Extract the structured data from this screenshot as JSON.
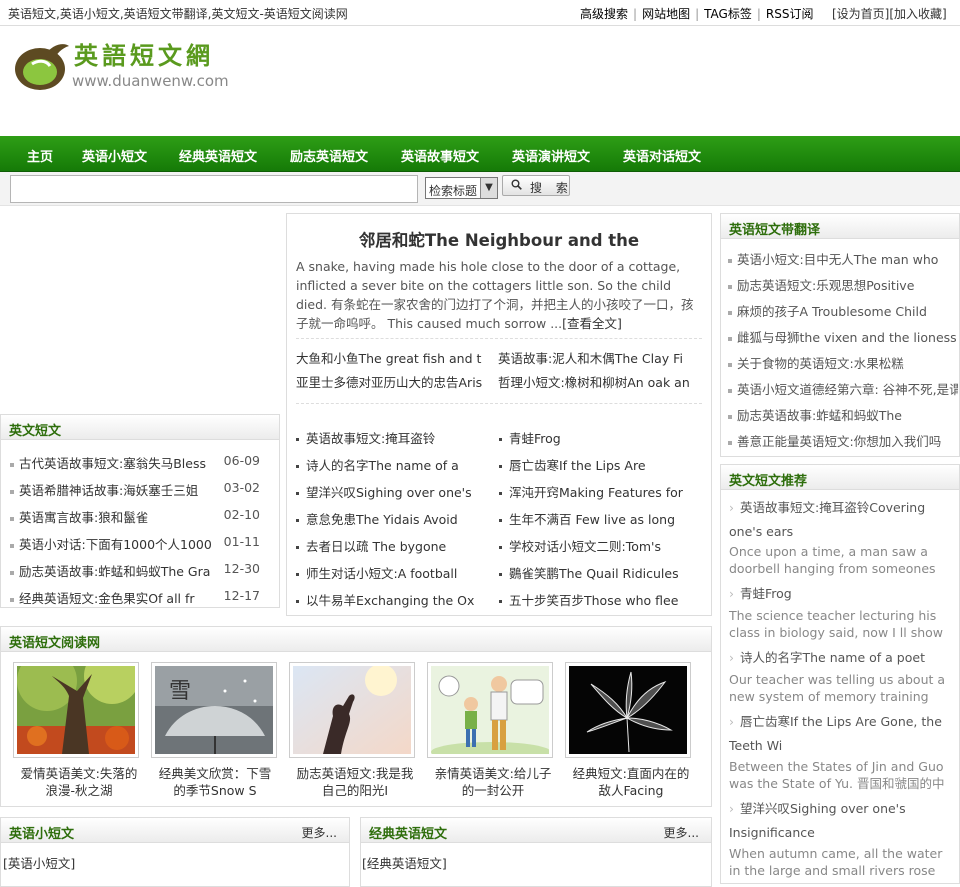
{
  "topbar": {
    "title": "英语短文,英语小短文,英语短文带翻译,英文短文-英语短文阅读网",
    "links": [
      "高级搜索",
      "网站地图",
      "TAG标签",
      "RSS订阅"
    ],
    "set_home": "[设为首页]",
    "add_fav": "[加入收藏]"
  },
  "logo": {
    "name": "英語短文網",
    "url": "www.duanwenw.com"
  },
  "nav": [
    "主页",
    "英语小短文",
    "经典英语短文",
    "励志英语短文",
    "英语故事短文",
    "英语演讲短文",
    "英语对话短文"
  ],
  "search": {
    "placeholder": "",
    "select_label": "检索标题",
    "button": "搜 索"
  },
  "left_box": {
    "title": "英文短文",
    "items": [
      {
        "text": "古代英语故事短文:塞翁失马Bless",
        "date": "06-09"
      },
      {
        "text": "英语希腊神话故事:海妖塞壬三姐",
        "date": "03-02"
      },
      {
        "text": "英语寓言故事:狼和鬣雀",
        "date": "02-10"
      },
      {
        "text": "英语小对话:下面有1000个人1000",
        "date": "01-11"
      },
      {
        "text": "励志英语故事:蚱蜢和蚂蚁The Gra",
        "date": "12-30"
      },
      {
        "text": "经典英语短文:金色果实Of all fr",
        "date": "12-17"
      }
    ]
  },
  "center": {
    "title": "邻居和蛇The Neighbour and the",
    "summary": "A snake, having made his hole close to the door of a cottage, inflicted a sever bite on the cottagers little son. So the child died. 有条蛇在一家农舍的门边打了个洞，并把主人的小孩咬了一口，孩子就一命呜呼。 This caused much sorrow ...",
    "summary_more": "[查看全文]",
    "top_links": [
      "大鱼和小鱼The great fish and t",
      "英语故事:泥人和木偶The Clay Fi",
      "亚里士多德对亚历山大的忠告Aris",
      "哲理小短文:橡树和柳树An oak an"
    ],
    "list_left": [
      "英语故事短文:掩耳盗铃",
      "诗人的名字The name of a",
      "望洋兴叹Sighing over one's",
      "意怠免患The Yidais Avoid",
      "去者日以疏 The bygone",
      "师生对话小短文:A football",
      "以牛易羊Exchanging the Ox"
    ],
    "list_right": [
      "青蛙Frog",
      "唇亡齿寒If the Lips Are",
      "浑沌开窍Making Features for",
      "生年不满百 Few live as long",
      "学校对话小短文二则:Tom's",
      "鷃雀笑鹏The Quail Ridicules",
      "五十步笑百步Those who flee"
    ]
  },
  "gallery": {
    "title": "英语短文阅读网",
    "items": [
      {
        "caption": "爱情英语美文:失落的浪漫-秋之湖"
      },
      {
        "caption": "经典美文欣赏：下雪的季节Snow S",
        "overlay": "雪"
      },
      {
        "caption": "励志英语短文:我是我自己的阳光I"
      },
      {
        "caption": "亲情英语美文:给儿子的一封公开"
      },
      {
        "caption": "经典短文:直面内在的敌人Facing"
      }
    ]
  },
  "bottom": {
    "left": {
      "title": "英语小短文",
      "more": "更多...",
      "link": "[英语小短文]"
    },
    "right": {
      "title": "经典英语短文",
      "more": "更多...",
      "link": "[经典英语短文]"
    }
  },
  "right_top": {
    "title": "英语短文带翻译",
    "items": [
      "英语小短文:目中无人The man who",
      "励志英语短文:乐观思想Positive",
      "麻烦的孩子A Troublesome Child",
      "雌狐与母狮the vixen and the lioness",
      "关于食物的英语短文:水果松糕",
      "英语小短文道德经第六章: 谷神不死,是谓",
      "励志英语故事:蚱蜢和蚂蚁The",
      "善意正能量英语短文:你想加入我们吗"
    ]
  },
  "right_rec": {
    "title": "英文短文推荐",
    "items": [
      {
        "title": "英语故事短文:掩耳盗铃Covering one's ears",
        "desc": "Once upon a time, a man saw a doorbell hanging from someones"
      },
      {
        "title": "青蛙Frog",
        "desc": "The science teacher lecturing his class in biology said, now I ll show"
      },
      {
        "title": "诗人的名字The name of a poet",
        "desc": "Our teacher was telling us about a new system of memory training"
      },
      {
        "title": "唇亡齿寒If the Lips Are Gone, the Teeth Wi",
        "desc": "Between the States of Jin and Guo was the State of Yu. 晋国和虢国的中"
      },
      {
        "title": "望洋兴叹Sighing over one's Insignificance",
        "desc": "When autumn came, all the water in the large and small rivers rose"
      }
    ]
  }
}
